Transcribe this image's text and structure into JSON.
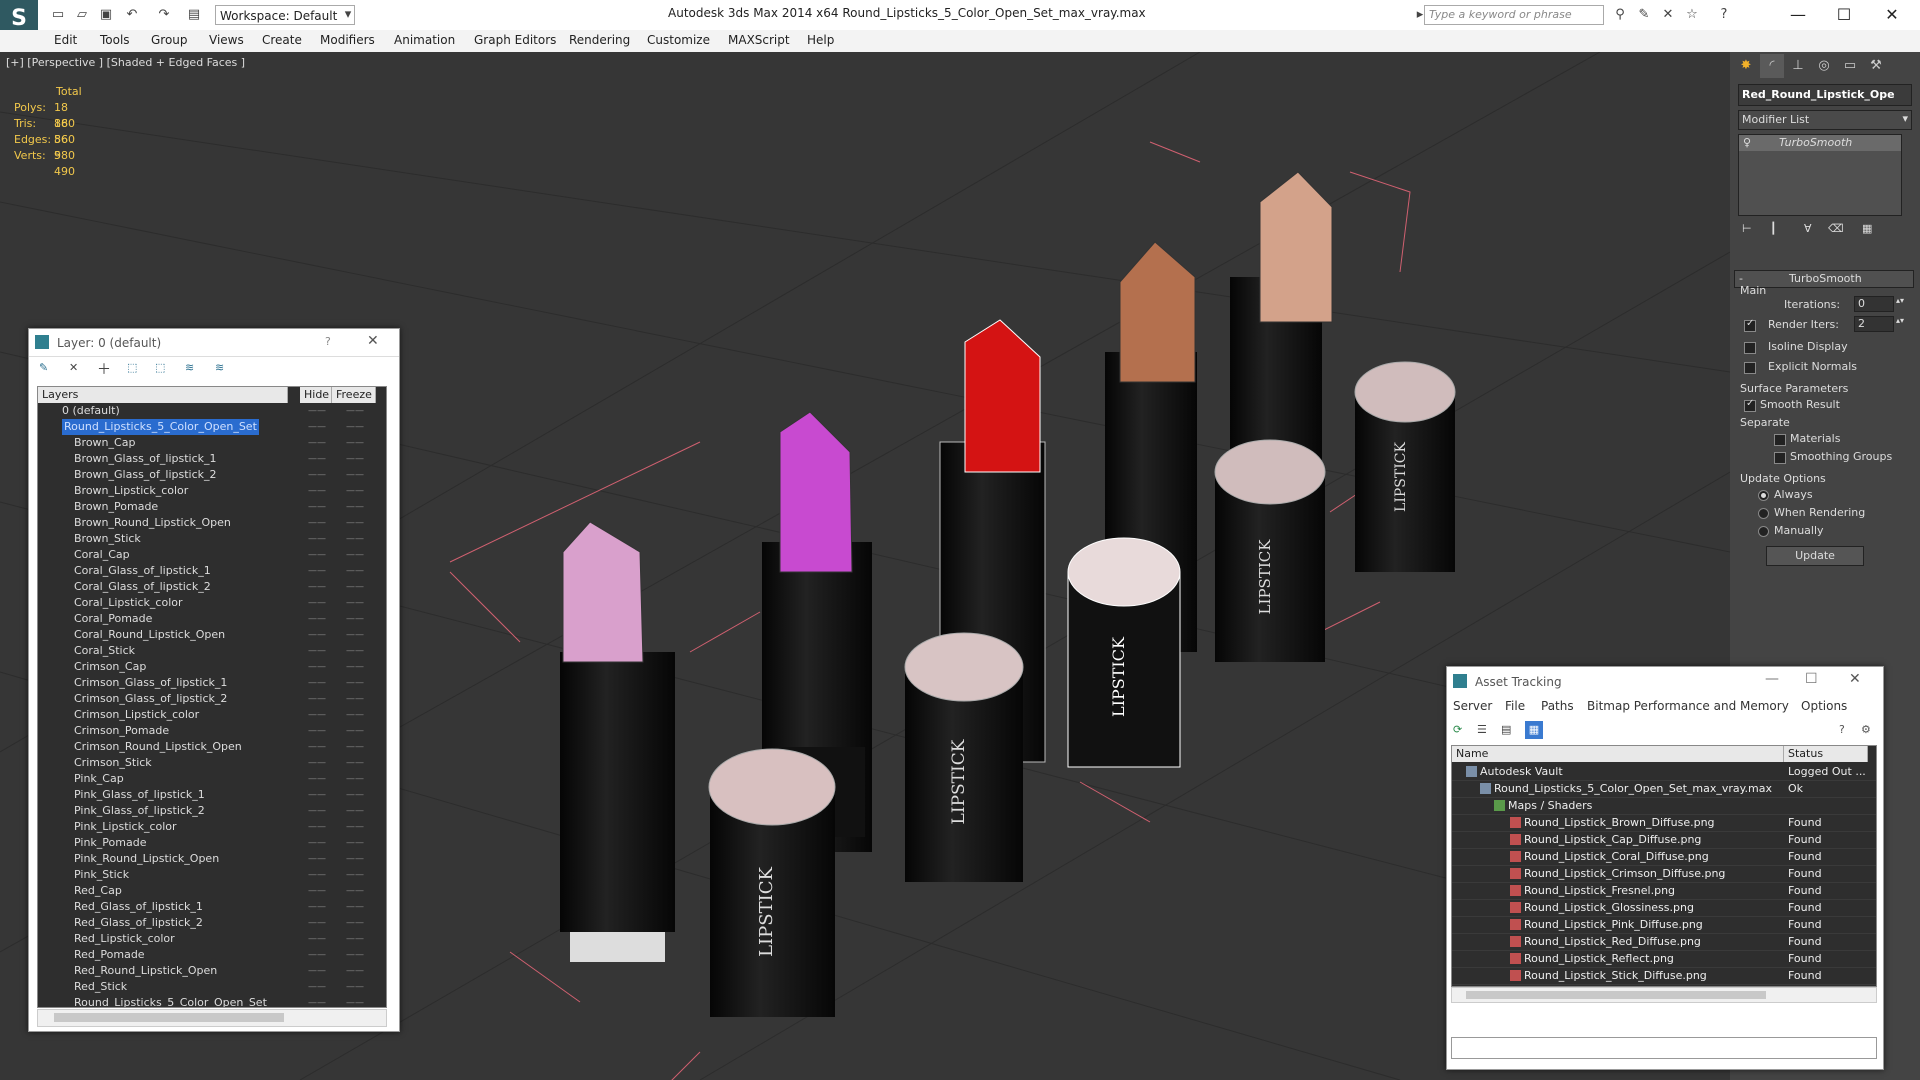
{
  "titlebar": {
    "title": "Autodesk 3ds Max  2014 x64        Round_Lipsticks_5_Color_Open_Set_max_vray.max",
    "workspace": "Workspace: Default",
    "search_placeholder": "Type a keyword or phrase"
  },
  "menubar": [
    "Edit",
    "Tools",
    "Group",
    "Views",
    "Create",
    "Modifiers",
    "Animation",
    "Graph Editors",
    "Rendering",
    "Customize",
    "MAXScript",
    "Help"
  ],
  "viewport": {
    "label": "[+] [Perspective ] [Shaded + Edged Faces ]",
    "stats": {
      "header": "Total",
      "polys_label": "Polys:",
      "polys": "18 860",
      "tris_label": "Tris:",
      "tris": "18 860",
      "edges_label": "Edges:",
      "edges": "56 580",
      "verts_label": "Verts:",
      "verts": "9 490"
    },
    "lipstick_text": "LIPSTICK"
  },
  "command_panel": {
    "object_name": "Red_Round_Lipstick_Ope",
    "modifier_list": "Modifier List",
    "stack_item": "TurboSmooth",
    "rollout_title": "TurboSmooth",
    "main_label": "Main",
    "iterations_label": "Iterations:",
    "iterations_value": "0",
    "render_iters_label": "Render Iters:",
    "render_iters_value": "2",
    "isoline": "Isoline Display",
    "explicit": "Explicit Normals",
    "surface_params": "Surface Parameters",
    "smooth_result": "Smooth Result",
    "separate": "Separate",
    "materials": "Materials",
    "smoothing_groups": "Smoothing Groups",
    "update_options": "Update Options",
    "always": "Always",
    "when_rendering": "When Rendering",
    "manually": "Manually",
    "update_button": "Update"
  },
  "layer_dialog": {
    "title": "Layer: 0 (default)",
    "col_layers": "Layers",
    "col_hide": "Hide",
    "col_freeze": "Freeze",
    "rows": [
      "0 (default)",
      "Round_Lipsticks_5_Color_Open_Set",
      "Brown_Cap",
      "Brown_Glass_of_lipstick_1",
      "Brown_Glass_of_lipstick_2",
      "Brown_Lipstick_color",
      "Brown_Pomade",
      "Brown_Round_Lipstick_Open",
      "Brown_Stick",
      "Coral_Cap",
      "Coral_Glass_of_lipstick_1",
      "Coral_Glass_of_lipstick_2",
      "Coral_Lipstick_color",
      "Coral_Pomade",
      "Coral_Round_Lipstick_Open",
      "Coral_Stick",
      "Crimson_Cap",
      "Crimson_Glass_of_lipstick_1",
      "Crimson_Glass_of_lipstick_2",
      "Crimson_Lipstick_color",
      "Crimson_Pomade",
      "Crimson_Round_Lipstick_Open",
      "Crimson_Stick",
      "Pink_Cap",
      "Pink_Glass_of_lipstick_1",
      "Pink_Glass_of_lipstick_2",
      "Pink_Lipstick_color",
      "Pink_Pomade",
      "Pink_Round_Lipstick_Open",
      "Pink_Stick",
      "Red_Cap",
      "Red_Glass_of_lipstick_1",
      "Red_Glass_of_lipstick_2",
      "Red_Lipstick_color",
      "Red_Pomade",
      "Red_Round_Lipstick_Open",
      "Red_Stick",
      "Round_Lipsticks_5_Color_Open_Set"
    ]
  },
  "asset_dialog": {
    "title": "Asset Tracking",
    "menu": [
      "Server",
      "File",
      "Paths",
      "Bitmap Performance and Memory",
      "Options"
    ],
    "col_name": "Name",
    "col_status": "Status",
    "rows": [
      {
        "name": "Autodesk Vault",
        "status": "Logged Out ..."
      },
      {
        "name": "Round_Lipsticks_5_Color_Open_Set_max_vray.max",
        "status": "Ok"
      },
      {
        "name": "Maps / Shaders",
        "status": ""
      },
      {
        "name": "Round_Lipstick_Brown_Diffuse.png",
        "status": "Found"
      },
      {
        "name": "Round_Lipstick_Cap_Diffuse.png",
        "status": "Found"
      },
      {
        "name": "Round_Lipstick_Coral_Diffuse.png",
        "status": "Found"
      },
      {
        "name": "Round_Lipstick_Crimson_Diffuse.png",
        "status": "Found"
      },
      {
        "name": "Round_Lipstick_Fresnel.png",
        "status": "Found"
      },
      {
        "name": "Round_Lipstick_Glossiness.png",
        "status": "Found"
      },
      {
        "name": "Round_Lipstick_Pink_Diffuse.png",
        "status": "Found"
      },
      {
        "name": "Round_Lipstick_Red_Diffuse.png",
        "status": "Found"
      },
      {
        "name": "Round_Lipstick_Reflect.png",
        "status": "Found"
      },
      {
        "name": "Round_Lipstick_Stick_Diffuse.png",
        "status": "Found"
      }
    ]
  }
}
